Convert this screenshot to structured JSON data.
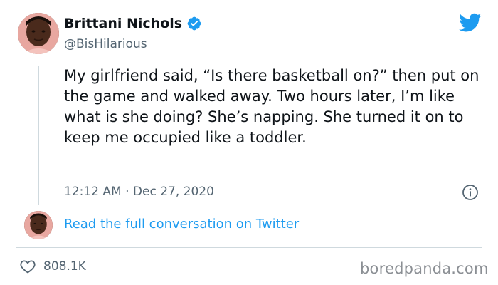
{
  "author": {
    "display_name": "Brittani Nichols",
    "handle": "@BisHilarious"
  },
  "tweet": {
    "text": "My girlfriend said, “Is there basketball on?” then put on the game and walked away. Two hours later, I’m like what is she doing? She’s napping. She turned it on to keep me occupied like a toddler.",
    "timestamp": "12:12 AM · Dec 27, 2020",
    "likes": "808.1K"
  },
  "conversation_link": "Read the full conversation on Twitter",
  "watermark": "boredpanda.com",
  "icons": {
    "verified": "verified-badge-icon",
    "brand": "twitter-bird-icon",
    "info": "info-icon",
    "like": "heart-icon"
  },
  "colors": {
    "accent": "#1d9bf0",
    "text": "#0f1419",
    "secondary_text": "#536471",
    "border": "#cfd9de"
  }
}
